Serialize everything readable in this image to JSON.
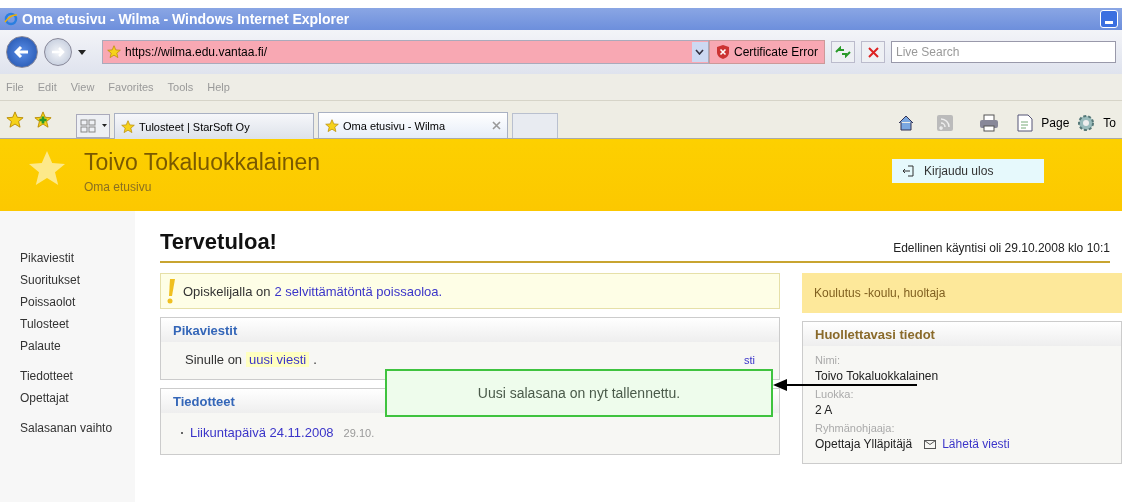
{
  "window": {
    "title": "Oma etusivu - Wilma - Windows Internet Explorer"
  },
  "address_bar": {
    "url": "https://wilma.edu.vantaa.fi/",
    "certificate_error": "Certificate Error"
  },
  "search": {
    "placeholder": "Live Search"
  },
  "menu": [
    "File",
    "Edit",
    "View",
    "Favorites",
    "Tools",
    "Help"
  ],
  "tabs": [
    {
      "label": "Tulosteet | StarSoft Oy",
      "selected": false
    },
    {
      "label": "Oma etusivu - Wilma",
      "selected": true
    }
  ],
  "command_bar": [
    "Page",
    "To"
  ],
  "header": {
    "name": "Toivo Tokaluokkalainen",
    "subtitle": "Oma etusivu",
    "logout": "Kirjaudu ulos"
  },
  "sidebar": {
    "groups": [
      [
        "Pikaviestit",
        "Suoritukset",
        "Poissaolot",
        "Tulosteet",
        "Palaute"
      ],
      [
        "Tiedotteet",
        "Opettajat"
      ],
      [
        "Salasanan vaihto"
      ]
    ]
  },
  "main": {
    "heading": "Tervetuloa!",
    "last_visit": "Edellinen käyntisi oli 29.10.2008 klo 10:1",
    "alert": {
      "prefix": "Opiskelijalla on",
      "link": "2 selvittämätöntä poissaoloa."
    },
    "messages": {
      "title": "Pikaviestit",
      "prefix": "Sinulle on",
      "link": "uusi viesti",
      "suffix": ".",
      "side_link": "sti"
    },
    "bulletins": {
      "title": "Tiedotteet",
      "items": [
        {
          "title": "Liikuntapäivä 24.11.2008",
          "date": "29.10."
        }
      ]
    }
  },
  "side": {
    "role": "Koulutus -koulu, huoltaja",
    "title": "Huollettavasi tiedot",
    "fields": [
      {
        "label": "Nimi:",
        "value": "Toivo Tokaluokkalainen"
      },
      {
        "label": "Luokka:",
        "value": "2 A"
      },
      {
        "label": "Ryhmänohjaaja:",
        "value": "Opettaja Ylläpitäjä",
        "link": "Lähetä viesti"
      }
    ]
  },
  "notification": {
    "text": "Uusi salasana on nyt tallennettu."
  }
}
